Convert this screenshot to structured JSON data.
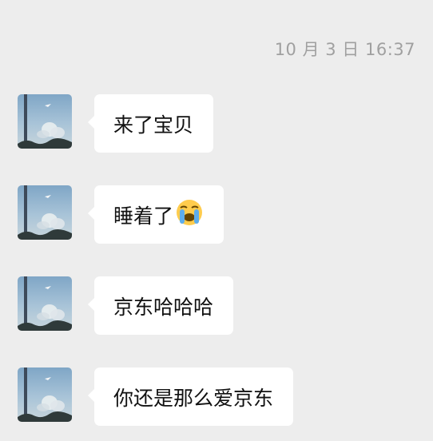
{
  "timestamp": "10 月 3 日 16:37",
  "messages": [
    {
      "text": "来了宝贝",
      "emoji": null
    },
    {
      "text": "睡着了",
      "emoji": "loudly-crying-face-icon"
    },
    {
      "text": "京东哈哈哈",
      "emoji": null
    },
    {
      "text": "你还是那么爱京东",
      "emoji": null
    }
  ],
  "colors": {
    "background": "#ededed",
    "bubble": "#ffffff",
    "timestamp": "#a0a0a0"
  }
}
